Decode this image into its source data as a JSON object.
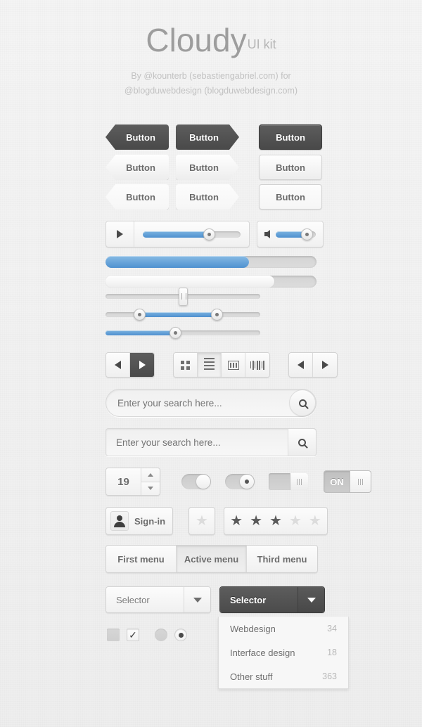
{
  "header": {
    "title": "Cloudy",
    "subtitle": "UI kit",
    "byline_1": "By @kounterb (sebastiengabriel.com) for",
    "byline_2": "@blogduwebdesign (blogduwebdesign.com)"
  },
  "colors": {
    "accent_blue": "#4f91d0",
    "dark": "#4f4f4f",
    "background": "#f2f2f2",
    "text_gray": "#6b6b6b"
  },
  "buttons": {
    "rows": [
      {
        "style": "dark",
        "labels": [
          "Button",
          "Button",
          "Button"
        ]
      },
      {
        "style": "light",
        "labels": [
          "Button",
          "Button",
          "Button"
        ]
      },
      {
        "style": "flat",
        "labels": [
          "Button",
          "Button",
          "Button"
        ]
      }
    ],
    "label": "Button"
  },
  "media_player": {
    "play_icon": "play-icon",
    "progress_percent": 68,
    "volume_icon": "speaker-icon",
    "volume_percent": 78
  },
  "progress_bars": [
    {
      "name": "blue-progress",
      "percent": 68
    },
    {
      "name": "light-progress",
      "percent": 80
    }
  ],
  "sliders": [
    {
      "name": "single-vertical-handle-slider",
      "value_percent": 50,
      "fill": false
    },
    {
      "name": "range-slider",
      "start_percent": 22,
      "end_percent": 72,
      "fill": true
    },
    {
      "name": "blue-slider",
      "value_percent": 45,
      "fill": true
    }
  ],
  "toolbar": {
    "nav_left_icon": "triangle-left-icon",
    "nav_right_icon": "triangle-right-icon",
    "view_modes": [
      {
        "name": "grid-view-icon",
        "active": false
      },
      {
        "name": "list-view-icon",
        "active": true
      },
      {
        "name": "column-view-icon",
        "active": false
      },
      {
        "name": "bars-view-icon",
        "active": false
      }
    ]
  },
  "search": {
    "placeholder": "Enter your search here...",
    "value": "",
    "icon": "search-icon"
  },
  "stepper": {
    "value": "19",
    "up_icon": "caret-up-icon",
    "down_icon": "caret-down-icon"
  },
  "toggles": [
    {
      "name": "toggle-pill-plain",
      "state": "on"
    },
    {
      "name": "toggle-pill-dot",
      "state": "on"
    },
    {
      "name": "toggle-square",
      "state": "on"
    },
    {
      "name": "toggle-on-label",
      "state": "on",
      "label": "ON"
    }
  ],
  "signin": {
    "label": "Sign-in",
    "icon": "user-icon"
  },
  "rating": {
    "single_star_filled": false,
    "stars_filled": 3,
    "stars_total": 5,
    "glyph": "★"
  },
  "menu_tabs": [
    {
      "label": "First menu",
      "active": false
    },
    {
      "label": "Active menu",
      "active": true
    },
    {
      "label": "Third menu",
      "active": false
    }
  ],
  "selectors": [
    {
      "name": "selector-light",
      "label": "Selector",
      "style": "light"
    },
    {
      "name": "selector-dark",
      "label": "Selector",
      "style": "dark"
    }
  ],
  "dropdown": {
    "items": [
      {
        "label": "Webdesign",
        "count": "34"
      },
      {
        "label": "Interface design",
        "count": "18"
      },
      {
        "label": "Other stuff",
        "count": "363"
      }
    ]
  },
  "choices": [
    {
      "name": "checkbox-unchecked",
      "type": "checkbox",
      "checked": false
    },
    {
      "name": "checkbox-checked",
      "type": "checkbox",
      "checked": true,
      "glyph": "✓"
    },
    {
      "name": "radio-unselected",
      "type": "radio",
      "selected": false
    },
    {
      "name": "radio-selected",
      "type": "radio",
      "selected": true
    }
  ]
}
